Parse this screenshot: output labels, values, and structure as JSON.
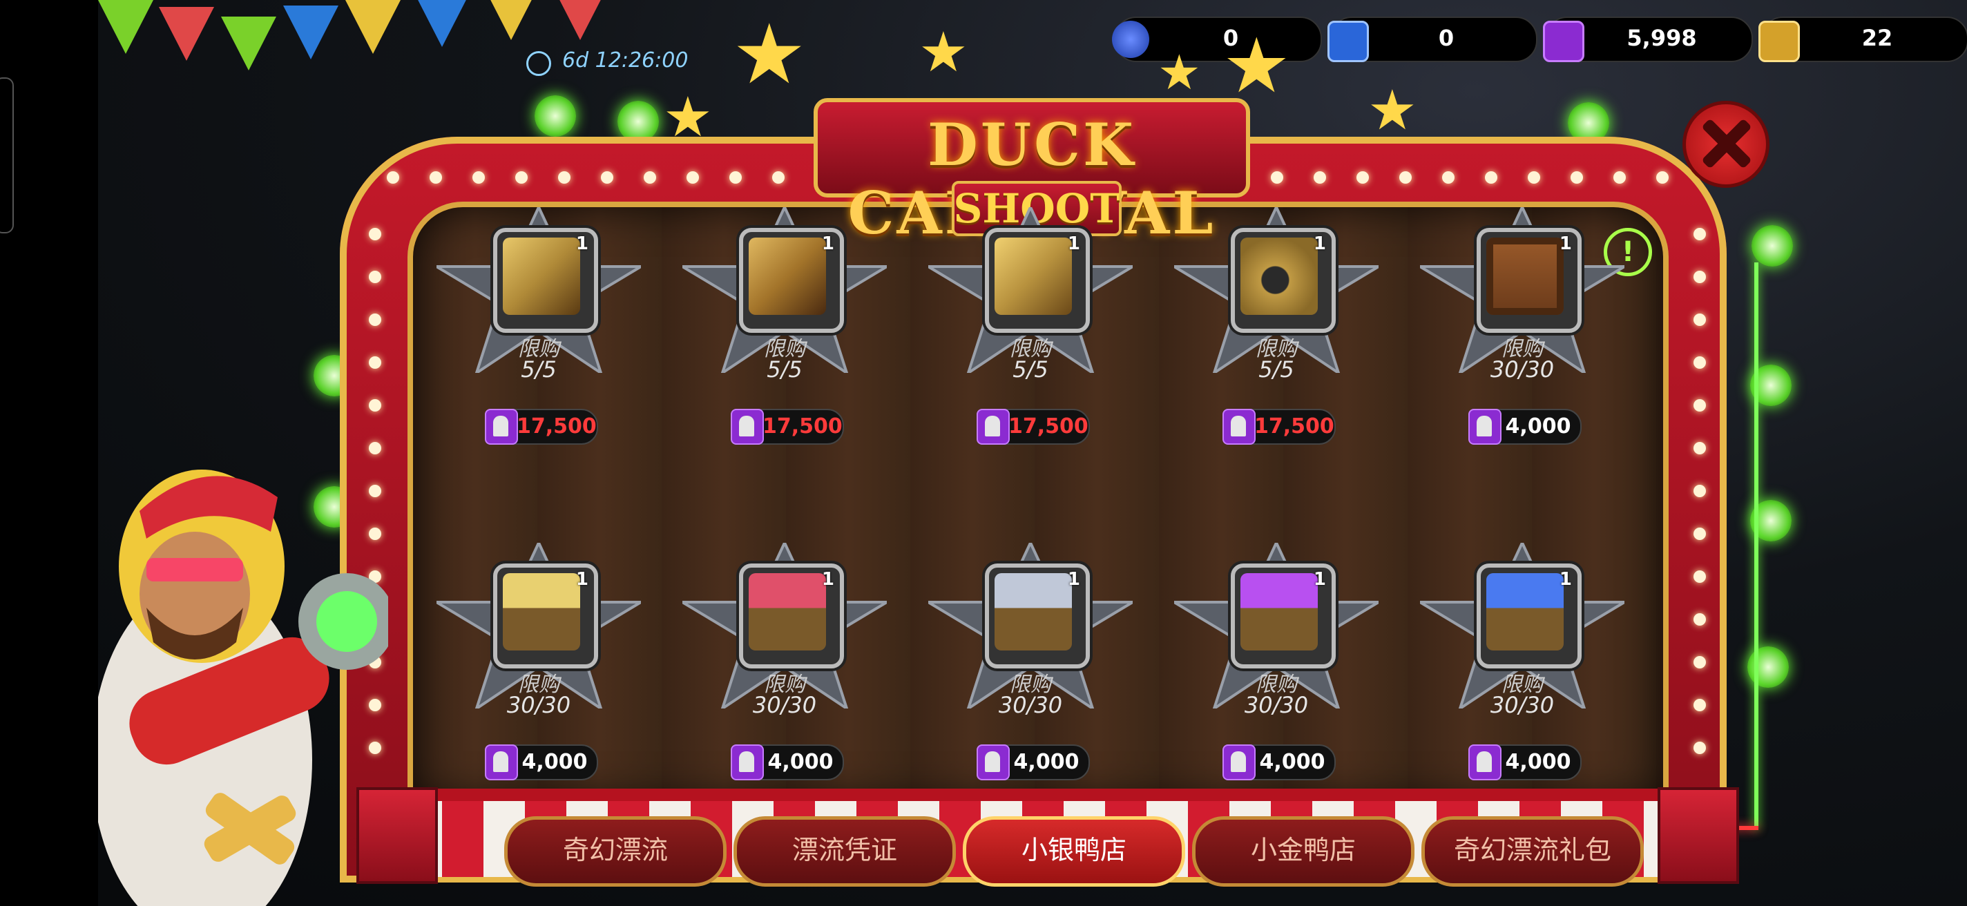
{
  "timer": "6d 12:26:00",
  "currencies": [
    {
      "icon": "blue-orb-icon",
      "value": "0",
      "color": "#2b5bd6"
    },
    {
      "icon": "blue-ticket-icon",
      "value": "0",
      "color": "#2a66d9"
    },
    {
      "icon": "silver-duck-icon",
      "value": "5,998",
      "color": "#8b2bd1"
    },
    {
      "icon": "gold-duck-icon",
      "value": "22",
      "color": "#d4a12a"
    }
  ],
  "banner": {
    "title": "DUCK CARNIVAL",
    "subtitle": "SHOOT"
  },
  "items": [
    {
      "icon": "gold-blueprint-card-icon",
      "qty": "1",
      "limit_label": "限购",
      "limit": "5/5",
      "price": "17,500",
      "price_color": "#ff3b3b",
      "art": "#b08a38"
    },
    {
      "icon": "gold-blueprint-card-icon",
      "qty": "1",
      "limit_label": "限购",
      "limit": "5/5",
      "price": "17,500",
      "price_color": "#ff3b3b",
      "art": "#a3742a"
    },
    {
      "icon": "gold-blueprint-card-icon",
      "qty": "1",
      "limit_label": "限购",
      "limit": "5/5",
      "price": "17,500",
      "price_color": "#ff3b3b",
      "art": "#b8923e"
    },
    {
      "icon": "gold-tire-card-icon",
      "qty": "1",
      "limit_label": "限购",
      "limit": "5/5",
      "price": "17,500",
      "price_color": "#ff3b3b",
      "art": "#c09a44"
    },
    {
      "icon": "supply-crate-icon",
      "qty": "1",
      "limit_label": "限购",
      "limit": "30/30",
      "price": "4,000",
      "price_color": "#ffffff",
      "art": "#6a3a1a"
    },
    {
      "icon": "gold-crystal-cart-icon",
      "qty": "1",
      "limit_label": "限购",
      "limit": "30/30",
      "price": "4,000",
      "price_color": "#ffffff",
      "art": "#c8a23a"
    },
    {
      "icon": "red-crystal-cart-icon",
      "qty": "1",
      "limit_label": "限购",
      "limit": "30/30",
      "price": "4,000",
      "price_color": "#ffffff",
      "art": "#c23a4a"
    },
    {
      "icon": "silver-crystal-cart-icon",
      "qty": "1",
      "limit_label": "限购",
      "limit": "30/30",
      "price": "4,000",
      "price_color": "#ffffff",
      "art": "#9aa3b8"
    },
    {
      "icon": "purple-crystal-cart-icon",
      "qty": "1",
      "limit_label": "限购",
      "limit": "30/30",
      "price": "4,000",
      "price_color": "#ffffff",
      "art": "#a040d8"
    },
    {
      "icon": "blue-crystal-cart-icon",
      "qty": "1",
      "limit_label": "限购",
      "limit": "30/30",
      "price": "4,000",
      "price_color": "#ffffff",
      "art": "#2f5fd8"
    }
  ],
  "tabs": [
    {
      "label": "奇幻漂流",
      "active": false
    },
    {
      "label": "漂流凭证",
      "active": false
    },
    {
      "label": "小银鸭店",
      "active": true
    },
    {
      "label": "小金鸭店",
      "active": false
    },
    {
      "label": "奇幻漂流礼包",
      "active": false
    }
  ]
}
